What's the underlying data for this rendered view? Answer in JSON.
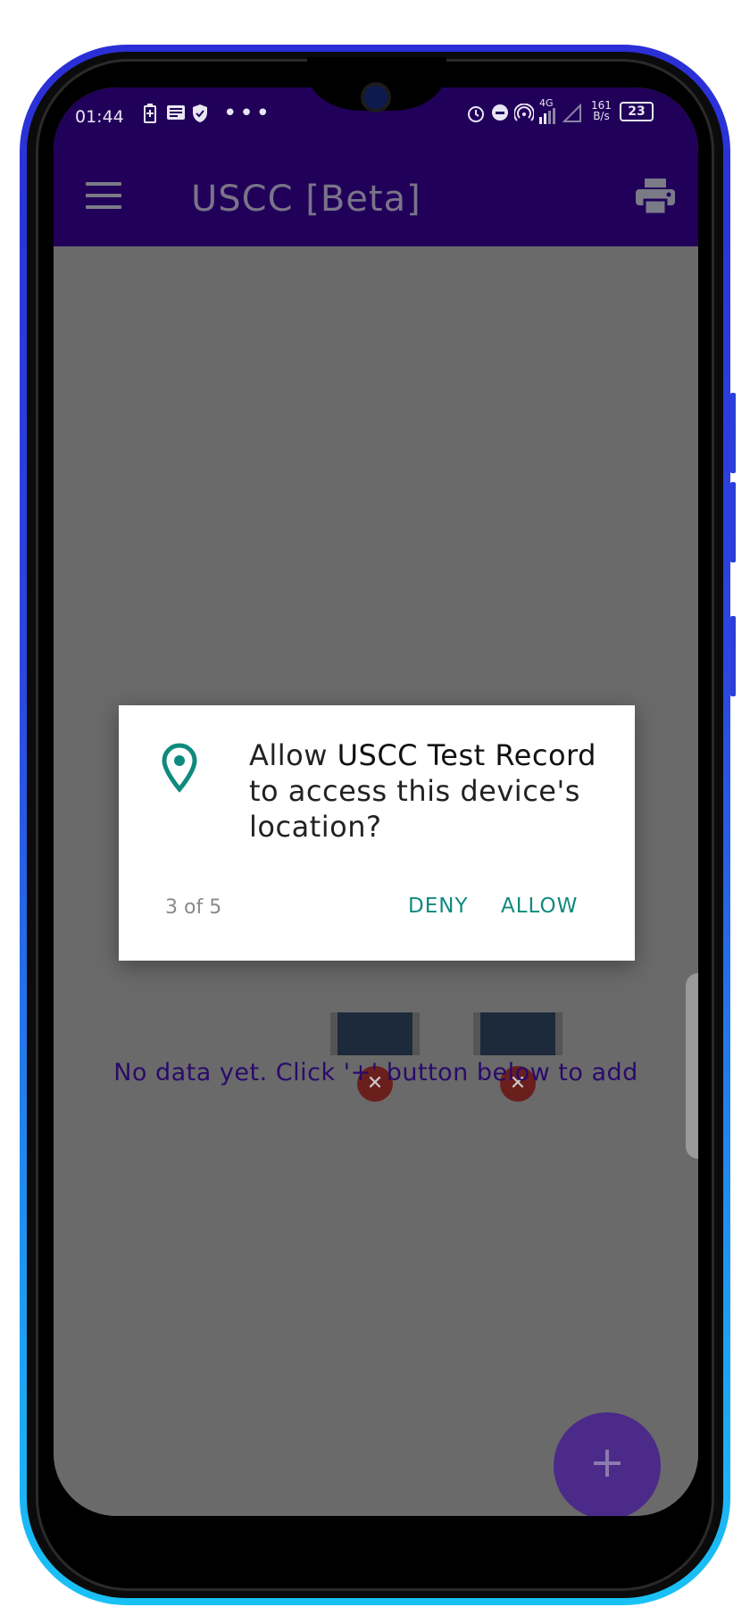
{
  "status_bar": {
    "time": "01:44",
    "left_icons": [
      "battery-saver-icon",
      "news-icon",
      "shield-icon",
      "more-dots-icon"
    ],
    "right_icons": [
      "alarm-icon",
      "dnd-icon",
      "hotspot-icon",
      "4g-signal-icon",
      "signal-icon"
    ],
    "network_4g": "4G",
    "speed_value": "161",
    "speed_unit": "B/s",
    "battery": "23"
  },
  "app_bar": {
    "title": "USCC [Beta]",
    "menu_icon": "hamburger-icon",
    "action_icon": "print-icon"
  },
  "main": {
    "empty_message": "No data yet. Click '+' button below to add",
    "fab_label": "+"
  },
  "dialog": {
    "icon": "location-pin-icon",
    "text_prefix": "Allow ",
    "app_name": "USCC Test Record",
    "text_suffix": " to access this device's location?",
    "counter": "3 of 5",
    "deny_label": "DENY",
    "allow_label": "ALLOW"
  },
  "colors": {
    "header": "#21005a",
    "accent": "#0f8a7e",
    "fab": "#4b2a8a",
    "scrim": "#6a6a6a"
  }
}
